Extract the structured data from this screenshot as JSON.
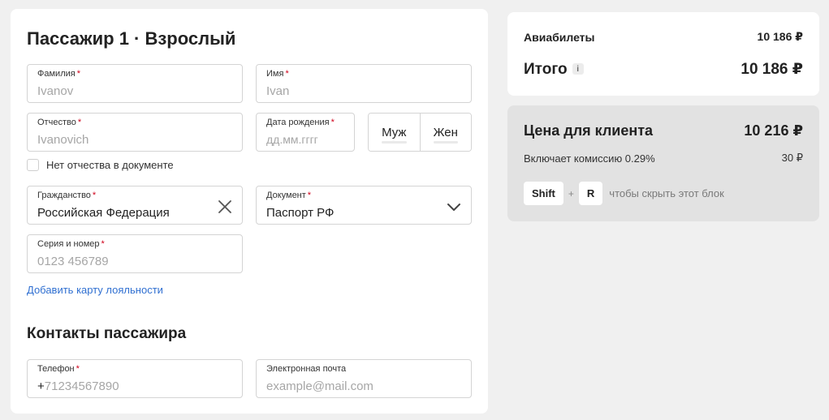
{
  "form": {
    "title": "Пассажир 1 · Взрослый",
    "lastname": {
      "label": "Фамилия",
      "required": "*",
      "placeholder": "Ivanov"
    },
    "firstname": {
      "label": "Имя",
      "required": "*",
      "placeholder": "Ivan"
    },
    "middlename": {
      "label": "Отчество",
      "required": "*",
      "placeholder": "Ivanovich"
    },
    "birthdate": {
      "label": "Дата рождения",
      "required": "*",
      "placeholder": "дд.мм.гггг"
    },
    "gender": {
      "male": "Муж",
      "female": "Жен"
    },
    "no_middlename": "Нет отчества в документе",
    "citizenship": {
      "label": "Гражданство",
      "required": "*",
      "value": "Российская Федерация",
      "icon": "clear-x-icon"
    },
    "document": {
      "label": "Документ",
      "required": "*",
      "value": "Паспорт РФ",
      "icon": "chevron-down-icon"
    },
    "doc_number": {
      "label": "Серия и номер",
      "required": "*",
      "placeholder": "0123 456789"
    },
    "loyalty_link": "Добавить карту лояльности"
  },
  "contacts": {
    "title": "Контакты пассажира",
    "phone": {
      "label": "Телефон",
      "required": "*",
      "prefix": "+",
      "placeholder": "71234567890"
    },
    "email": {
      "label": "Электронная почта",
      "placeholder": "example@mail.com"
    }
  },
  "summary": {
    "tickets_label": "Авиабилеты",
    "tickets_value": "10 186 ₽",
    "total_label": "Итого",
    "total_info": "i",
    "total_value": "10 186 ₽"
  },
  "client": {
    "price_label": "Цена для клиента",
    "price_value": "10 216 ₽",
    "commission_label": "Включает комиссию 0.29%",
    "commission_value": "30 ₽",
    "key1": "Shift",
    "plus": "+",
    "key2": "R",
    "hint": "чтобы скрыть этот блок"
  },
  "colors": {
    "accent_link": "#2f6fd1",
    "required": "#d0021b",
    "client_bg": "#e2e2e2"
  }
}
